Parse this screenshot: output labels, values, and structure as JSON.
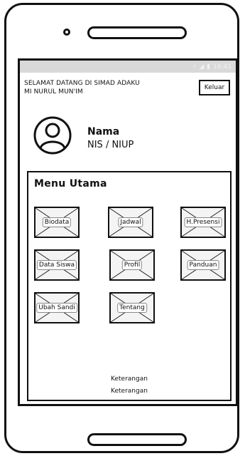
{
  "status_bar": {
    "time": "16:41",
    "icons": [
      "wifi-icon",
      "signal-icon",
      "battery-icon"
    ],
    "background": "#d9d9d9"
  },
  "header": {
    "welcome_line1": "SELAMAT DATANG DI SIMAD ADAKU",
    "welcome_line2": "MI NURUL MUN'IM",
    "logout_label": "Keluar"
  },
  "profile": {
    "name": "Nama",
    "id_label": "NIS / NIUP",
    "avatar_icon": "user-avatar-icon"
  },
  "menu": {
    "title": "Menu Utama",
    "items": [
      {
        "label": "Biodata"
      },
      {
        "label": "Jadwal"
      },
      {
        "label": "H.Presensi"
      },
      {
        "label": "Data Siswa"
      },
      {
        "label": "Profil"
      },
      {
        "label": "Panduan"
      },
      {
        "label": "Ubah Sandi"
      },
      {
        "label": "Tentang"
      }
    ]
  },
  "footer": {
    "line1": "Keterangan",
    "line2": "Keterangan"
  }
}
